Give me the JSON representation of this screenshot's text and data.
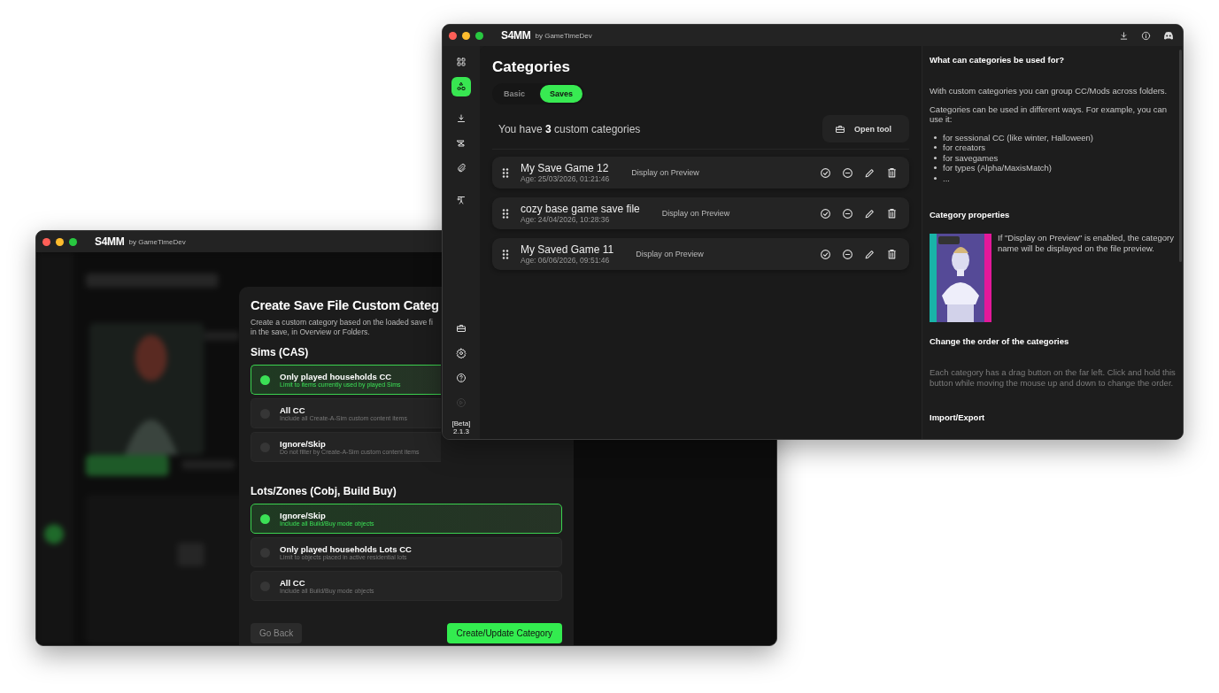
{
  "back_window": {
    "logo": "S4MM",
    "by": "by GameTimeDev",
    "dialog": {
      "title": "Create Save File Custom Categ",
      "description": [
        "Create a custom category based on the loaded save fi",
        "in the save, in Overview or Folders."
      ],
      "sections": [
        {
          "heading": "Sims (CAS)",
          "options": [
            {
              "title": "Only played households CC",
              "subtitle": "Limit to items currently used by played Sims",
              "selected": true
            },
            {
              "title": "All CC",
              "subtitle": "Include all Create-A-Sim custom content items",
              "selected": false
            },
            {
              "title": "Ignore/Skip",
              "subtitle": "Do not filter by Create-A-Sim custom content items",
              "selected": false
            }
          ]
        },
        {
          "heading": "Lots/Zones (Cobj, Build Buy)",
          "options": [
            {
              "title": "Ignore/Skip",
              "subtitle": "Include all Build/Buy mode objects",
              "selected": true
            },
            {
              "title": "Only played households Lots CC",
              "subtitle": "Limit to objects placed in active residential lots",
              "selected": false
            },
            {
              "title": "All CC",
              "subtitle": "Include all Build/Buy mode objects",
              "selected": false
            }
          ]
        }
      ],
      "buttons": [
        {
          "label": "Go Back",
          "kind": "secondary"
        },
        {
          "label": "Create/Update Category",
          "kind": "primary"
        }
      ]
    }
  },
  "front_window": {
    "logo": "S4MM",
    "by": "by GameTimeDev",
    "sidebar": {
      "items": [
        {
          "selected": false,
          "disabled": false
        },
        {
          "selected": true,
          "disabled": false
        },
        {
          "selected": false,
          "disabled": false
        },
        {
          "selected": false,
          "disabled": false
        },
        {
          "selected": false,
          "disabled": false
        },
        {
          "selected": false,
          "disabled": false
        }
      ],
      "bottom_items": [
        {
          "selected": false,
          "disabled": false
        },
        {
          "selected": false,
          "disabled": false
        },
        {
          "selected": false,
          "disabled": false
        },
        {
          "selected": false,
          "disabled": true
        }
      ],
      "version": [
        "[Beta]",
        "2.1.3"
      ]
    },
    "title": "Categories",
    "tabs": [
      {
        "label": "Basic",
        "selected": false
      },
      {
        "label": "Saves",
        "selected": true
      }
    ],
    "summary": "You have **3** custom categories",
    "open_tool": "Open tool",
    "categories": [
      {
        "name": "My Save Game 12",
        "age": "Age: 25/03/2026, 01:21:46",
        "flag": "Display on Preview"
      },
      {
        "name": "cozy base game save file",
        "age": "Age: 24/04/2026, 10:28:36",
        "flag": "Display on Preview"
      },
      {
        "name": "My Saved Game 11",
        "age": "Age: 06/06/2026, 09:51:46",
        "flag": "Display on Preview"
      }
    ],
    "help": [
      {
        "kind": "heading",
        "text": "What can categories be used for?"
      },
      {
        "kind": "text",
        "text": "With custom categories you can group CC/Mods across folders."
      },
      {
        "kind": "text",
        "text": "Categories can be used in different ways. For example, you can use it:"
      },
      {
        "kind": "list",
        "items": [
          "for sessional CC (like winter, Halloween)",
          "for creators",
          "for savegames",
          "for types (Alpha/MaxisMatch)",
          "..."
        ]
      },
      {
        "kind": "heading",
        "text": "Category properties"
      },
      {
        "kind": "figure",
        "text": "If \"Display on Preview\" is enabled, the category name will be displayed on the file preview."
      },
      {
        "kind": "heading",
        "text": "Change the order of the categories"
      },
      {
        "kind": "note",
        "text": "Each category has a drag button on the far left. Click and hold this button while moving the mouse up and down to change the order."
      },
      {
        "kind": "heading",
        "text": "Import/Export"
      }
    ]
  }
}
